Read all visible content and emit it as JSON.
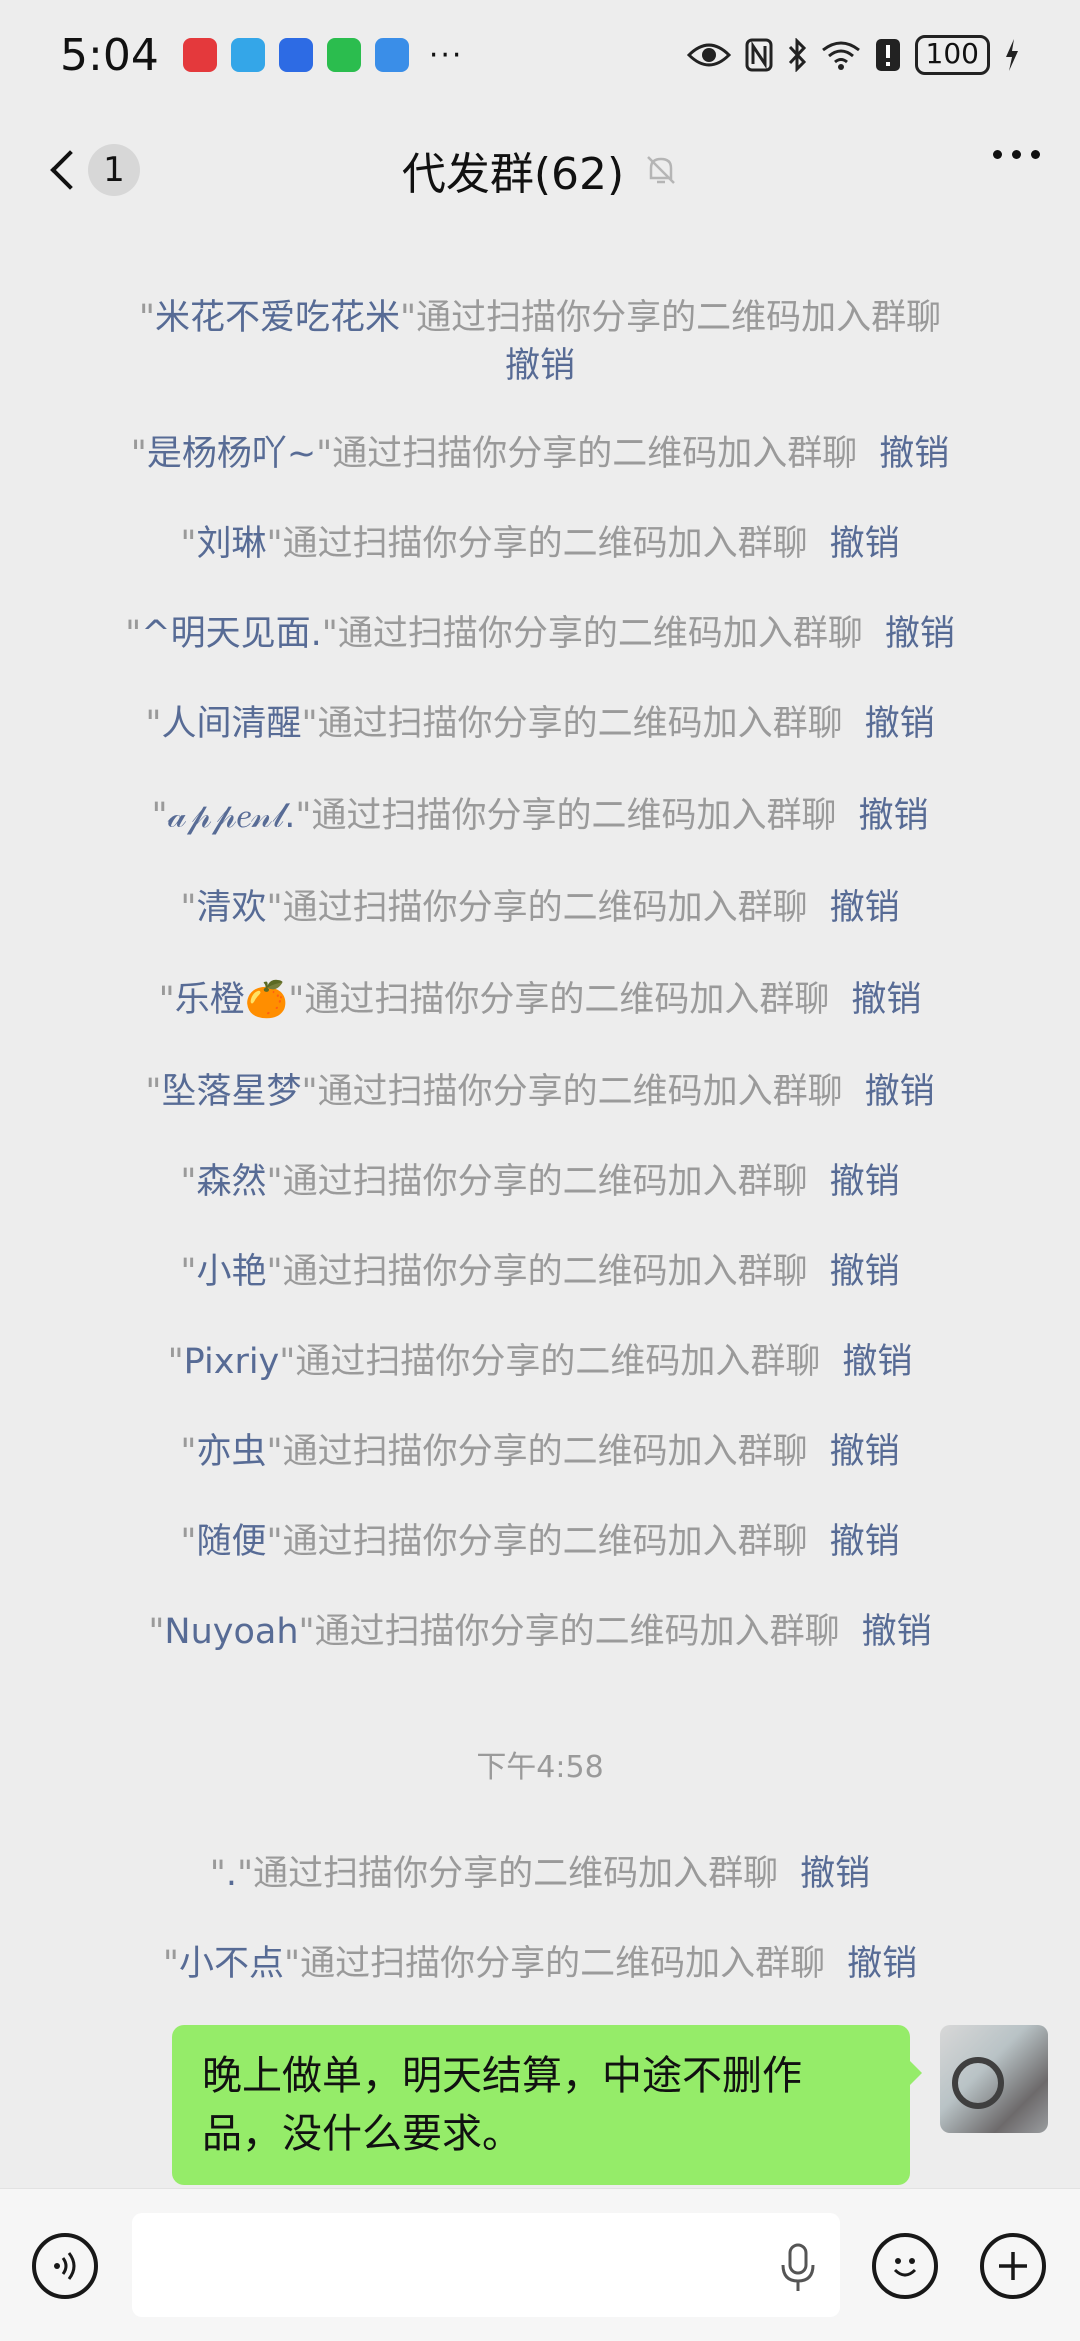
{
  "status_bar": {
    "time": "5:04",
    "app_icons": [
      "red-app-icon",
      "blue-app-icon",
      "blue-bulb-app-icon",
      "wechat-icon",
      "weather-icon"
    ],
    "dots": "···",
    "battery": "100"
  },
  "header": {
    "unread_count": "1",
    "title": "代发群(62)"
  },
  "messages": [
    {
      "quote_l": "\"",
      "name": "米花不爱吃花米",
      "quote_r": "\"",
      "text": "通过扫描你分享的二维码加入群聊",
      "revoke": "撤销"
    },
    {
      "quote_l": "\"",
      "name": "是杨杨吖~",
      "quote_r": "\"",
      "text": "通过扫描你分享的二维码加入群聊",
      "revoke": "撤销"
    },
    {
      "quote_l": "\"",
      "name": "刘琳",
      "quote_r": "\"",
      "text": "通过扫描你分享的二维码加入群聊",
      "revoke": "撤销"
    },
    {
      "quote_l": "\"",
      "name": "^明天见面.",
      "quote_r": "\"",
      "text": "通过扫描你分享的二维码加入群聊",
      "revoke": "撤销"
    },
    {
      "quote_l": "\"",
      "name": "人间清醒",
      "quote_r": "\"",
      "text": "通过扫描你分享的二维码加入群聊",
      "revoke": "撤销"
    },
    {
      "quote_l": "\"",
      "name": "𝒶𝓅𝓅𝑒𝓃𝓁.",
      "quote_r": "\"",
      "text": "通过扫描你分享的二维码加入群聊",
      "revoke": "撤销"
    },
    {
      "quote_l": "\"",
      "name": "清欢",
      "quote_r": "\"",
      "text": "通过扫描你分享的二维码加入群聊",
      "revoke": "撤销"
    },
    {
      "quote_l": "\"",
      "name": "乐橙🍊",
      "quote_r": "\"",
      "text": "通过扫描你分享的二维码加入群聊",
      "revoke": "撤销"
    },
    {
      "quote_l": "\"",
      "name": "坠落星梦",
      "quote_r": "\"",
      "text": "通过扫描你分享的二维码加入群聊",
      "revoke": "撤销"
    },
    {
      "quote_l": "\"",
      "name": "森然",
      "quote_r": "\"",
      "text": "通过扫描你分享的二维码加入群聊",
      "revoke": "撤销"
    },
    {
      "quote_l": "\"",
      "name": "小艳",
      "quote_r": "\"",
      "text": "通过扫描你分享的二维码加入群聊",
      "revoke": "撤销"
    },
    {
      "quote_l": "\"",
      "name": "Pixriy",
      "quote_r": "\"",
      "text": "通过扫描你分享的二维码加入群聊",
      "revoke": "撤销"
    },
    {
      "quote_l": "\"",
      "name": "亦虫",
      "quote_r": "\"",
      "text": "通过扫描你分享的二维码加入群聊",
      "revoke": "撤销"
    },
    {
      "quote_l": "\"",
      "name": "随便",
      "quote_r": "\"",
      "text": "通过扫描你分享的二维码加入群聊",
      "revoke": "撤销"
    },
    {
      "quote_l": "\"",
      "name": "Nuyoah",
      "quote_r": "\"",
      "text": "通过扫描你分享的二维码加入群聊",
      "revoke": "撤销"
    }
  ],
  "time_divider": "下午4:58",
  "after_messages": [
    {
      "quote_l": "\"",
      "name": ".",
      "quote_r": "\"",
      "text": "通过扫描你分享的二维码加入群聊",
      "revoke": "撤销"
    },
    {
      "quote_l": "\"",
      "name": "小不点",
      "quote_r": "\"",
      "text": "通过扫描你分享的二维码加入群聊",
      "revoke": "撤销"
    }
  ],
  "bubble": {
    "text": "晚上做单，明天结算，中途不删作品，没什么要求。"
  },
  "colors": {
    "bubble": "#95ec69",
    "link": "#576b95",
    "system_text": "#9a9a9a",
    "background": "#ededed"
  }
}
